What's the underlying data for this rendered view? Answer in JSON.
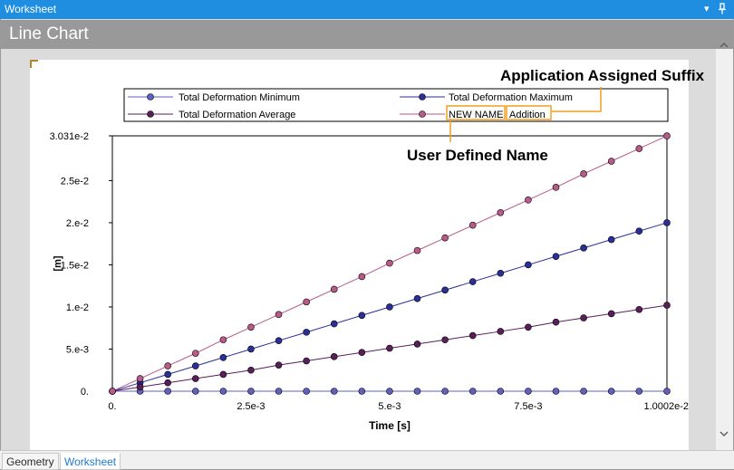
{
  "window": {
    "title": "Worksheet",
    "dropdown_icon": "▾",
    "pin_icon": "pin-icon"
  },
  "header": {
    "title": "Line Chart"
  },
  "legend": {
    "items": [
      {
        "label": "Total Deformation Minimum",
        "color": "#6060c0"
      },
      {
        "label": "Total Deformation Maximum",
        "color": "#2a2f9a"
      },
      {
        "label": "Total Deformation Average",
        "color": "#5a1e5a"
      },
      {
        "label_name": "NEW NAME",
        "label_suffix": "Addition",
        "color": "#b85a8a"
      }
    ]
  },
  "annotations": {
    "suffix": "Application Assigned Suffix",
    "name": "User Defined Name",
    "highlight_color": "#f0a020"
  },
  "chart_data": {
    "type": "line",
    "xlabel": "Time [s]",
    "ylabel": "[m]",
    "xlim": [
      0,
      0.010002
    ],
    "ylim": [
      0,
      0.03031
    ],
    "x_ticks": [
      "0.",
      "2.5e-3",
      "5.e-3",
      "7.5e-3",
      "1.0002e-2"
    ],
    "y_ticks": [
      "0.",
      "5.e-3",
      "1.e-2",
      "1.5e-2",
      "2.e-2",
      "2.5e-2",
      "3.031e-2"
    ],
    "x": [
      0,
      0.0005,
      0.001,
      0.0015,
      0.002,
      0.0025,
      0.003,
      0.0035,
      0.004,
      0.0045,
      0.005,
      0.0055,
      0.006,
      0.0065,
      0.007,
      0.0075,
      0.008,
      0.0085,
      0.009,
      0.0095,
      0.010002
    ],
    "series": [
      {
        "name": "Total Deformation Minimum",
        "color": "#6060c0",
        "values": [
          0,
          0,
          0,
          0,
          0,
          0,
          0,
          0,
          0,
          0,
          0,
          0,
          0,
          0,
          0,
          0,
          0,
          0,
          0,
          0,
          0
        ]
      },
      {
        "name": "Total Deformation Maximum",
        "color": "#2a2f9a",
        "values": [
          0,
          0.001,
          0.002,
          0.003,
          0.004,
          0.005,
          0.006,
          0.007,
          0.008,
          0.009,
          0.01,
          0.011,
          0.012,
          0.013,
          0.014,
          0.015,
          0.016,
          0.017,
          0.018,
          0.019,
          0.02
        ]
      },
      {
        "name": "Total Deformation Average",
        "color": "#5a1e5a",
        "values": [
          0,
          0.0005,
          0.001,
          0.0015,
          0.002,
          0.0025,
          0.0031,
          0.0036,
          0.0041,
          0.0046,
          0.0051,
          0.0056,
          0.0061,
          0.0066,
          0.0071,
          0.0076,
          0.0082,
          0.0087,
          0.0092,
          0.0097,
          0.0102
        ]
      },
      {
        "name": "NEW NAME Addition",
        "color": "#b85a8a",
        "values": [
          0,
          0.0015,
          0.003,
          0.0045,
          0.0061,
          0.0076,
          0.0091,
          0.0106,
          0.0121,
          0.0136,
          0.0152,
          0.0167,
          0.0182,
          0.0197,
          0.0212,
          0.0227,
          0.0242,
          0.0258,
          0.0273,
          0.0288,
          0.0303
        ]
      }
    ]
  },
  "tabs": [
    {
      "label": "Geometry",
      "active": false
    },
    {
      "label": "Worksheet",
      "active": true
    }
  ]
}
